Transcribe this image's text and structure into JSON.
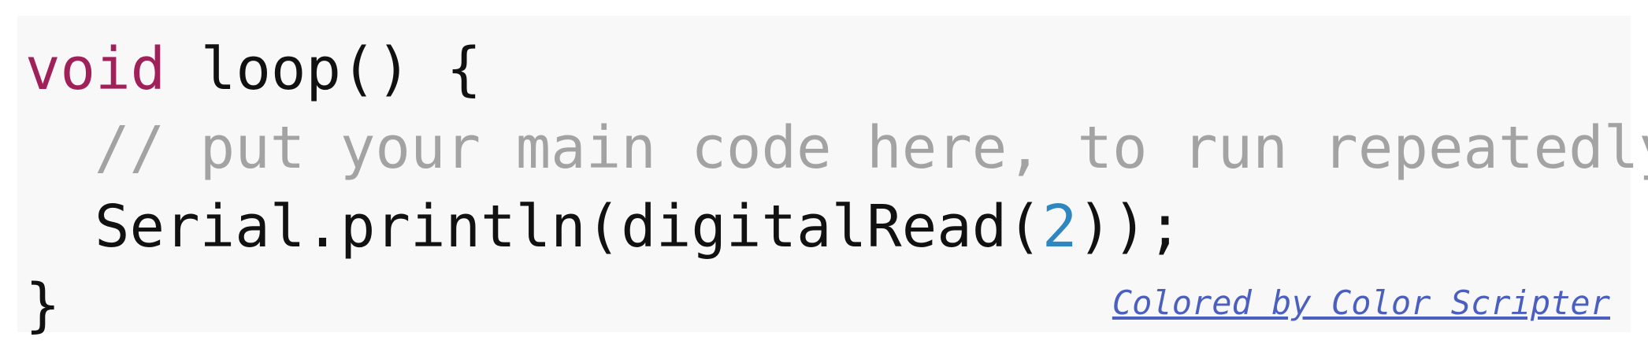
{
  "code": {
    "line1": {
      "keyword": "void",
      "rest": " loop() {"
    },
    "line2": {
      "comment": "// put your main code here, to run repeatedly:"
    },
    "line3": {
      "before_number": "Serial.println(digitalRead(",
      "number": "2",
      "after_number": "));"
    },
    "line4": {
      "text": "}"
    }
  },
  "credit": {
    "label": "Colored by Color Scripter"
  },
  "colors": {
    "keyword": "#a0205a",
    "comment": "#a3a3a3",
    "number": "#2f87c1",
    "link": "#4a5fc0",
    "background": "#f8f8f8"
  }
}
